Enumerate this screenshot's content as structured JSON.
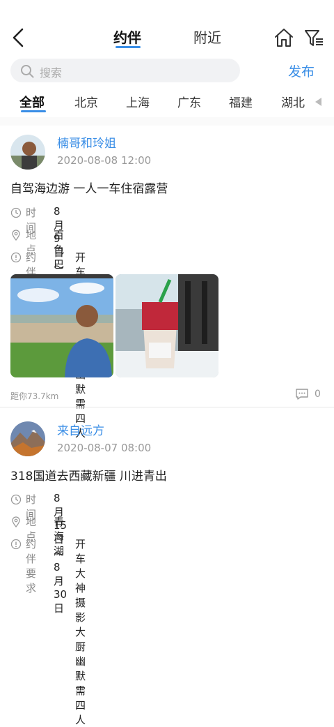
{
  "header": {
    "tabs": [
      {
        "label": "约伴",
        "active": true
      },
      {
        "label": "附近",
        "active": false
      }
    ],
    "icons": [
      "back-arrow-icon",
      "home-icon",
      "filter-icon"
    ]
  },
  "search": {
    "placeholder": "搜索",
    "publish_label": "发布"
  },
  "cities": {
    "items": [
      "全部",
      "北京",
      "上海",
      "广东",
      "福建",
      "湖北"
    ],
    "selected": "全部"
  },
  "colors": {
    "accent": "#3a8ee6",
    "muted": "#999999",
    "text": "#222222"
  },
  "posts": [
    {
      "user": "楠哥和玲姐",
      "time": "2020-08-08 12:00",
      "title": "自驾海边游 一人一车住宿露营",
      "time_label": "时间",
      "time_value": "8月9日～8月12日",
      "place_label": "地点",
      "place_value": "百色巴马",
      "req_label": "约伴要求",
      "req_value": "开车大神 摄影 大厨 幽默 需四人",
      "distance": "距你73.7km",
      "comments": "0"
    },
    {
      "user": "来自远方",
      "time": "2020-08-07 08:00",
      "title": "318国道去西藏新疆 川进青出",
      "time_label": "时间",
      "time_value": "8月15日～8月30日",
      "place_label": "地点",
      "place_value": "青海湖",
      "req_label": "约伴要求",
      "req_value": "开车大神 摄影 大厨 幽默 需四人"
    }
  ]
}
